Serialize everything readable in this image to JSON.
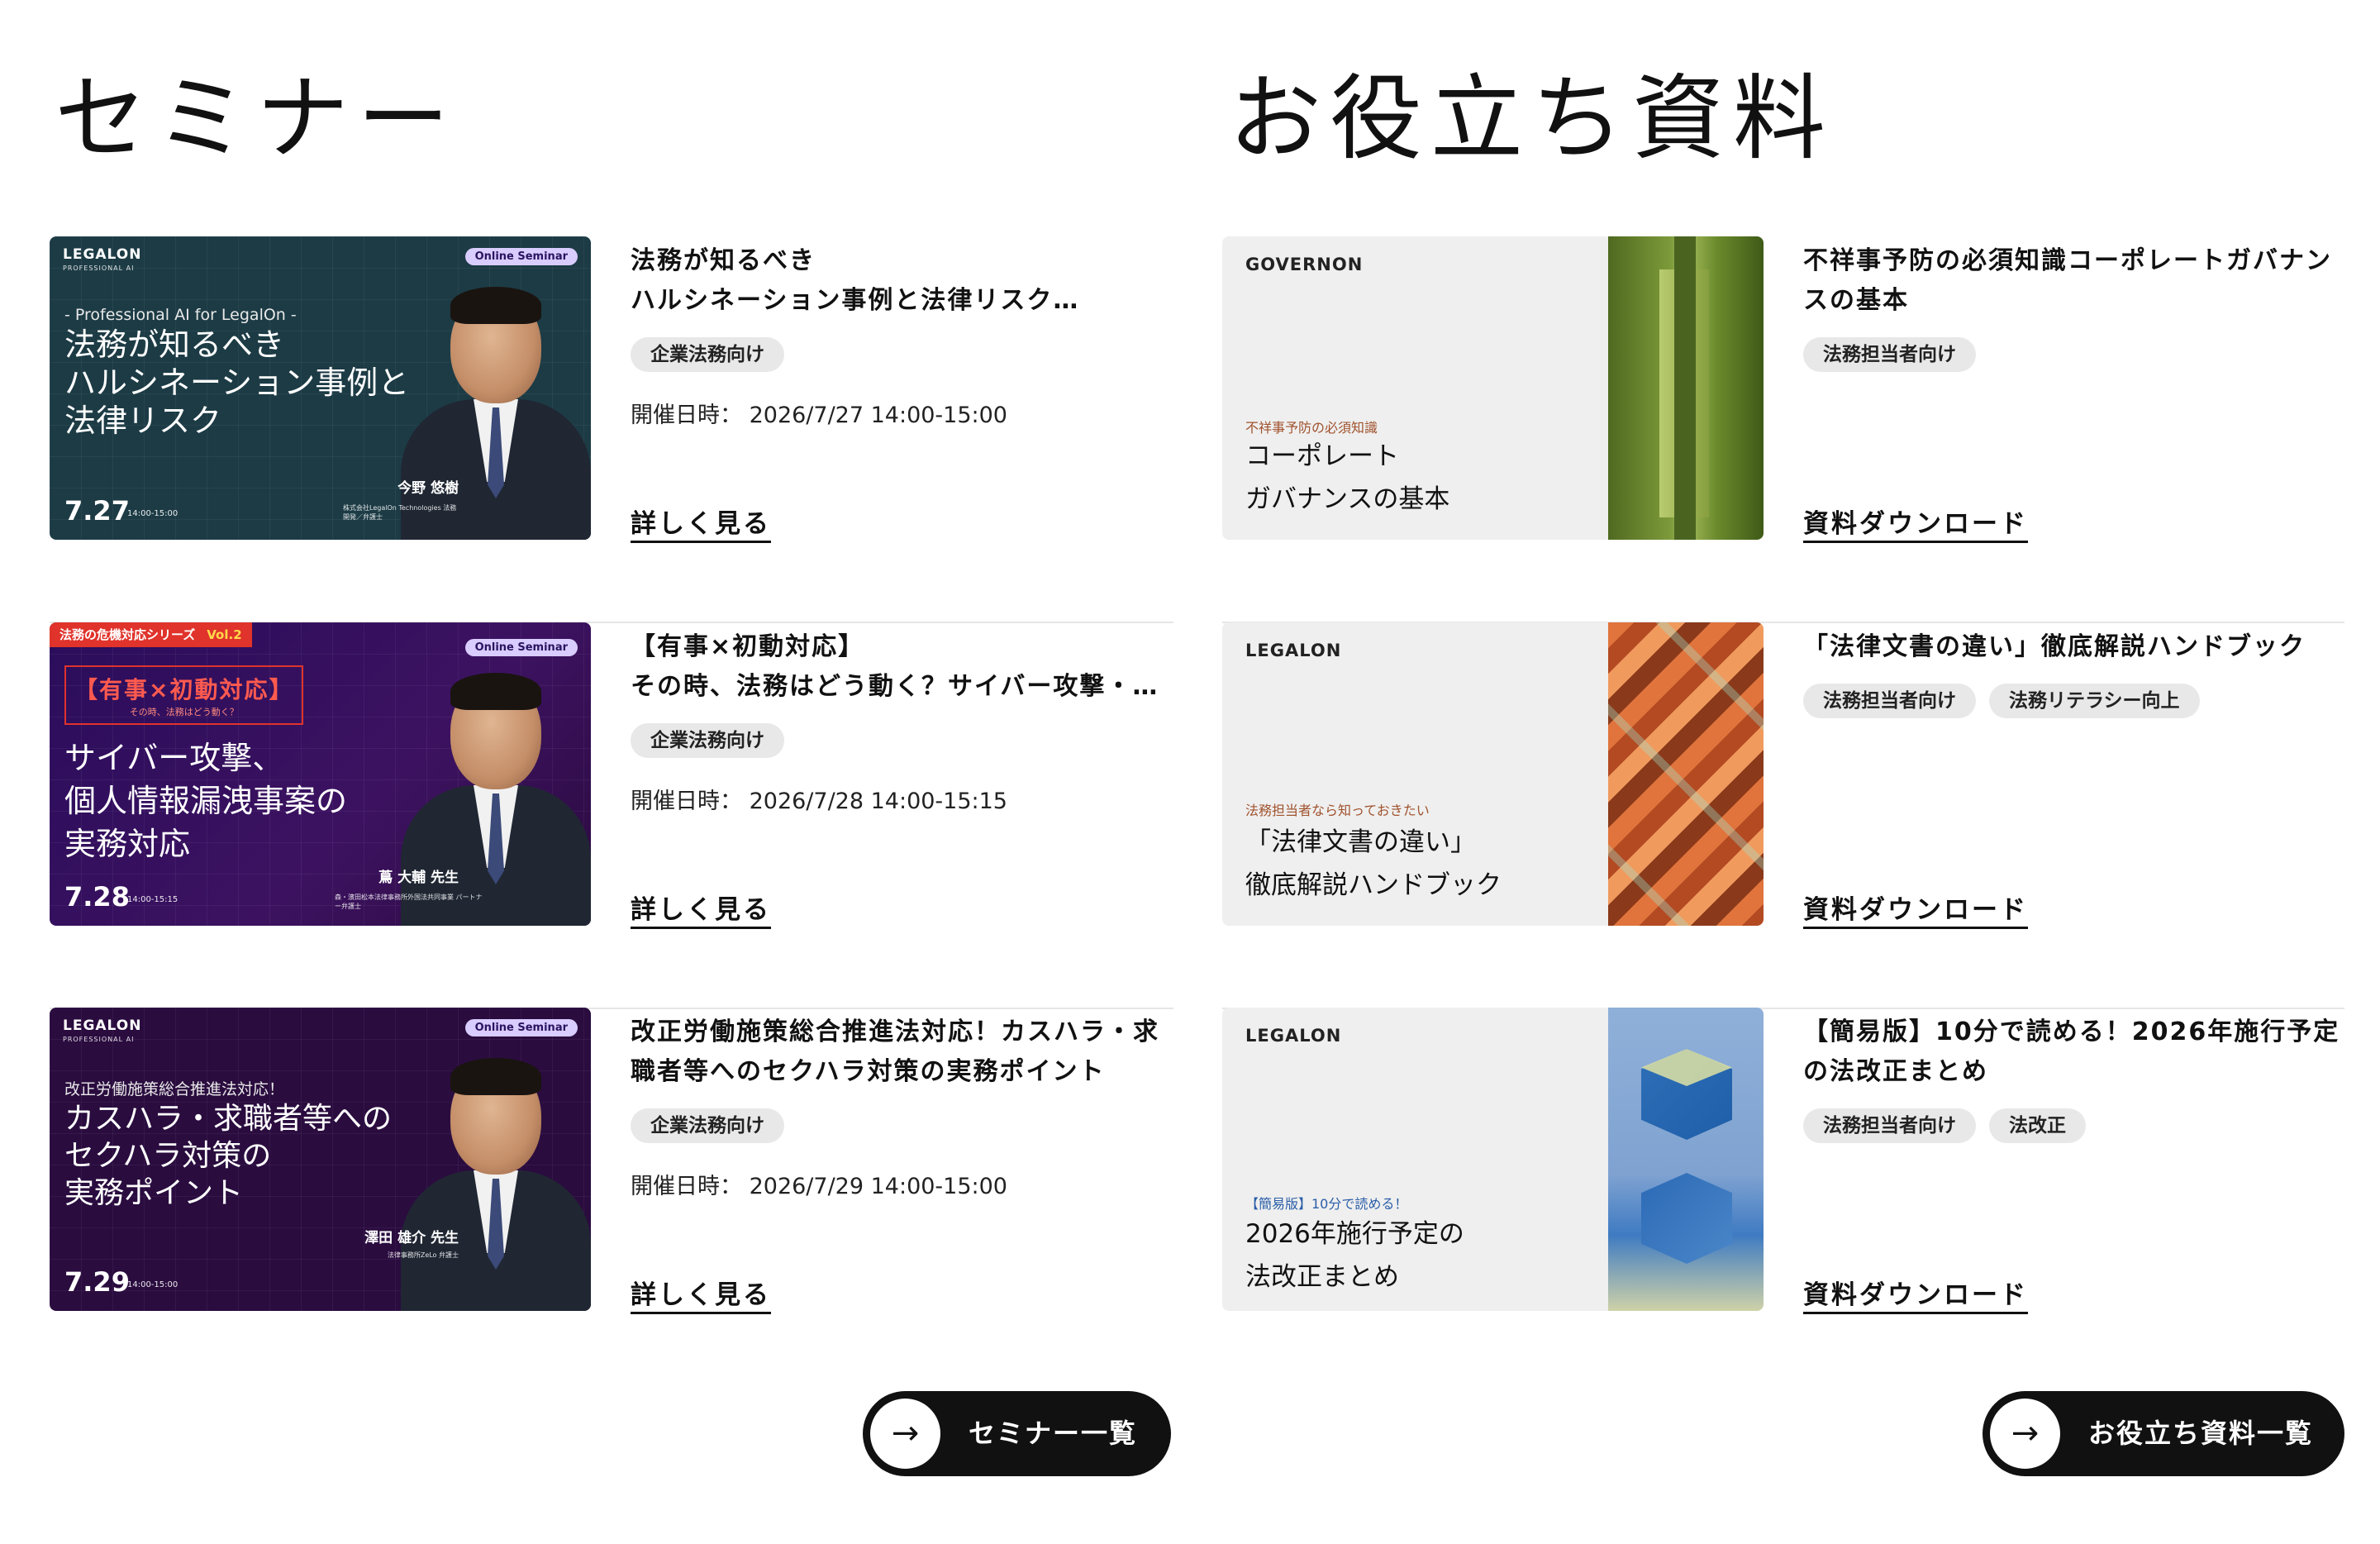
{
  "seminar": {
    "title": "セミナー",
    "list_button": "セミナー一覧",
    "cards": [
      {
        "title": "法務が知るべき\nハルシネーション事例と法律リスク…",
        "tags": [
          "企業法務向け"
        ],
        "date_label": "開催日時：",
        "date": "2026/7/27 14:00-15:00",
        "more": "詳しく見る",
        "thumb": {
          "logo": "LEGALON",
          "logo_sub": "PROFESSIONAL AI",
          "badge": "Online Seminar",
          "eyebrow": "- Professional AI for LegalOn -",
          "headline": "法務が知るべき\nハルシネーション事例と\n法律リスク",
          "day": "7.27",
          "time": "14:00-15:00",
          "speaker": "今野 悠樹",
          "speaker_sub": "株式会社LegalOn Technologies 法務開発／弁護士"
        }
      },
      {
        "title": "【有事×初動対応】\nその時、法務はどう動く？サイバー攻撃・…",
        "tags": [
          "企業法務向け"
        ],
        "date_label": "開催日時：",
        "date": "2026/7/28 14:00-15:15",
        "more": "詳しく見る",
        "thumb": {
          "series": "法務の危機対応シリーズ",
          "vol": "Vol.2",
          "badge": "Online Seminar",
          "bracket": "【有事×初動対応】",
          "bracket_sub": "その時、法務はどう動く？",
          "headline": "サイバー攻撃、\n個人情報漏洩事案の\n実務対応",
          "day": "7.28",
          "time": "14:00-15:15",
          "speaker": "蔦 大輔 先生",
          "speaker_sub": "森・濱田松本法律事務所外国法共同事業 パートナー弁護士"
        }
      },
      {
        "title": "改正労働施策総合推進法対応！カスハラ・求職者等へのセクハラ対策の実務ポイント",
        "tags": [
          "企業法務向け"
        ],
        "date_label": "開催日時：",
        "date": "2026/7/29 14:00-15:00",
        "more": "詳しく見る",
        "thumb": {
          "logo": "LEGALON",
          "logo_sub": "PROFESSIONAL AI",
          "badge": "Online Seminar",
          "eyebrow": "改正労働施策総合推進法対応！",
          "headline": "カスハラ・求職者等への\nセクハラ対策の\n実務ポイント",
          "day": "7.29",
          "time": "14:00-15:00",
          "speaker": "澤田 雄介 先生",
          "speaker_sub": "法律事務所ZeLo 弁護士"
        }
      }
    ]
  },
  "resources": {
    "title": "お役立ち資料",
    "list_button": "お役立ち資料一覧",
    "cards": [
      {
        "title": "不祥事予防の必須知識コーポレートガバナンスの基本",
        "tags": [
          "法務担当者向け"
        ],
        "more": "資料ダウンロード",
        "thumb": {
          "logo": "GOVERNON",
          "eyebrow": "不祥事予防の必須知識",
          "eyebrow_color": "#a0522d",
          "headline": "コーポレート\nガバナンスの基本"
        }
      },
      {
        "title": "「法律文書の違い」徹底解説ハンドブック",
        "tags": [
          "法務担当者向け",
          "法務リテラシー向上"
        ],
        "more": "資料ダウンロード",
        "thumb": {
          "logo": "LEGALON",
          "eyebrow": "法務担当者なら知っておきたい",
          "eyebrow_color": "#a0522d",
          "headline": "「法律文書の違い」\n徹底解説ハンドブック"
        }
      },
      {
        "title": "【簡易版】10分で読める！2026年施行予定の法改正まとめ",
        "tags": [
          "法務担当者向け",
          "法改正"
        ],
        "more": "資料ダウンロード",
        "thumb": {
          "logo": "LEGALON",
          "eyebrow": "【簡易版】10分で読める！",
          "eyebrow_color": "#2a5ea8",
          "headline": "2026年施行予定の\n法改正まとめ"
        }
      }
    ]
  }
}
